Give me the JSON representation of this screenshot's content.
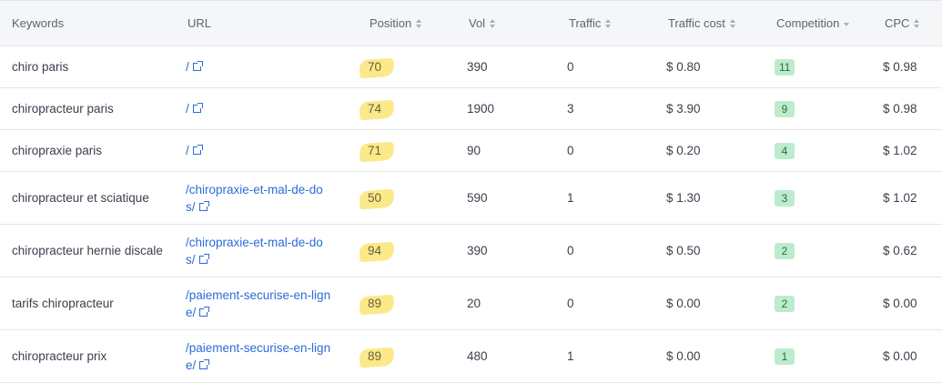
{
  "columns": {
    "keywords": "Keywords",
    "url": "URL",
    "position": "Position",
    "vol": "Vol",
    "traffic": "Traffic",
    "traffic_cost": "Traffic cost",
    "competition": "Competition",
    "cpc": "CPC"
  },
  "rows": [
    {
      "keyword": "chiro paris",
      "url_lines": [
        "/"
      ],
      "position": "70",
      "vol": "390",
      "traffic": "0",
      "traffic_cost": "$ 0.80",
      "competition": "11",
      "cpc": "$ 0.98"
    },
    {
      "keyword": "chiropracteur paris",
      "url_lines": [
        "/"
      ],
      "position": "74",
      "vol": "1900",
      "traffic": "3",
      "traffic_cost": "$ 3.90",
      "competition": "9",
      "cpc": "$ 0.98"
    },
    {
      "keyword": "chiropraxie paris",
      "url_lines": [
        "/"
      ],
      "position": "71",
      "vol": "90",
      "traffic": "0",
      "traffic_cost": "$ 0.20",
      "competition": "4",
      "cpc": "$ 1.02"
    },
    {
      "keyword": "chiropracteur et sciatique",
      "url_lines": [
        "/chiropraxie-et-mal-de-do",
        "s/"
      ],
      "position": "50",
      "vol": "590",
      "traffic": "1",
      "traffic_cost": "$ 1.30",
      "competition": "3",
      "cpc": "$ 1.02"
    },
    {
      "keyword": "chiropracteur hernie discale",
      "url_lines": [
        "/chiropraxie-et-mal-de-do",
        "s/"
      ],
      "position": "94",
      "vol": "390",
      "traffic": "0",
      "traffic_cost": "$ 0.50",
      "competition": "2",
      "cpc": "$ 0.62"
    },
    {
      "keyword": "tarifs chiropracteur",
      "url_lines": [
        "/paiement-securise-en-lign",
        "e/"
      ],
      "position": "89",
      "vol": "20",
      "traffic": "0",
      "traffic_cost": "$ 0.00",
      "competition": "2",
      "cpc": "$ 0.00"
    },
    {
      "keyword": "chiropracteur prix",
      "url_lines": [
        "/paiement-securise-en-lign",
        "e/"
      ],
      "position": "89",
      "vol": "480",
      "traffic": "1",
      "traffic_cost": "$ 0.00",
      "competition": "1",
      "cpc": "$ 0.00"
    }
  ],
  "colors": {
    "link": "#2b6cd8",
    "highlight": "#fbe98a",
    "badge_bg": "#bdeccd",
    "badge_text": "#2c6a44",
    "header_bg": "#f5f6f8"
  },
  "icons": {
    "sort": "sort-icon",
    "sort_desc": "sort-desc-icon",
    "external_link": "external-link-icon"
  }
}
